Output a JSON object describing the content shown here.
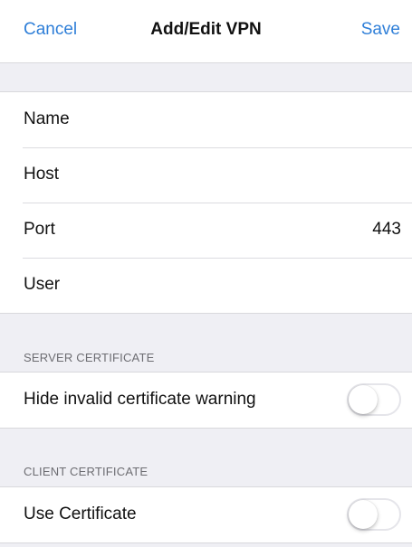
{
  "navbar": {
    "cancel_label": "Cancel",
    "title": "Add/Edit VPN",
    "save_label": "Save"
  },
  "fields": [
    {
      "label": "Name",
      "value": ""
    },
    {
      "label": "Host",
      "value": ""
    },
    {
      "label": "Port",
      "value": "443"
    },
    {
      "label": "User",
      "value": ""
    }
  ],
  "server_certificate": {
    "header": "SERVER CERTIFICATE",
    "toggle_label": "Hide invalid certificate warning",
    "toggle_on": false
  },
  "client_certificate": {
    "header": "CLIENT CERTIFICATE",
    "toggle_label": "Use Certificate",
    "toggle_on": false
  },
  "colors": {
    "accent": "#2f7fd8",
    "background": "#efeff4",
    "separator": "#d8d8dc"
  }
}
